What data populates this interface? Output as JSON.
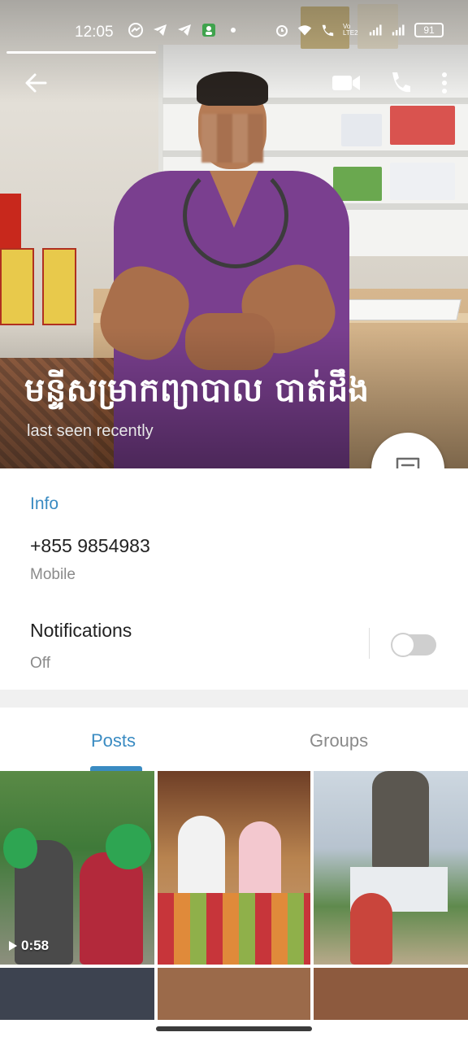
{
  "status_bar": {
    "time": "12:05",
    "battery": "91",
    "lte_label": "Vo LTE2",
    "icons": [
      "messenger-icon",
      "telegram-icon",
      "telegram-icon",
      "contacts-icon",
      "dot-icon",
      "alarm-icon",
      "wifi-icon",
      "call-wifi-icon",
      "signal-icon",
      "signal-icon"
    ]
  },
  "header": {
    "name": "មន្ទីសម្រាកព្យាបាល បាត់ដឹង",
    "last_seen": "last seen recently"
  },
  "info": {
    "title": "Info",
    "phone": "+855 9854983",
    "phone_label": "Mobile",
    "notifications_label": "Notifications",
    "notifications_value": "Off",
    "notifications_enabled": false
  },
  "tabs": {
    "posts": "Posts",
    "groups": "Groups",
    "active": "Posts"
  },
  "grid": {
    "first_video_duration": "0:58"
  },
  "colors": {
    "accent": "#3a8bc2",
    "scrubs": "#7a3f8f"
  }
}
